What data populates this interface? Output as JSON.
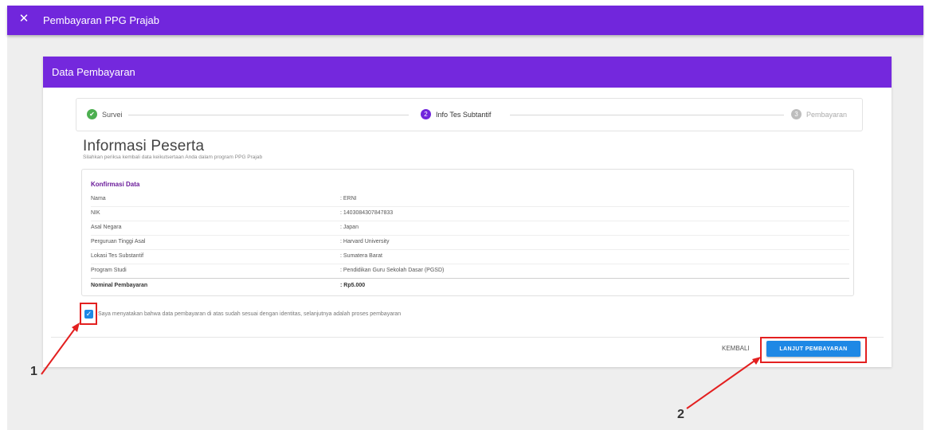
{
  "appbar": {
    "close_icon": "close-icon",
    "title": "Pembayaran PPG Prajab"
  },
  "card": {
    "header_title": "Data Pembayaran"
  },
  "stepper": {
    "steps": [
      {
        "number": "1",
        "label": "Survei",
        "state": "done"
      },
      {
        "number": "2",
        "label": "Info Tes Subtantif",
        "state": "active"
      },
      {
        "number": "3",
        "label": "Pembayaran",
        "state": "inactive"
      }
    ]
  },
  "info": {
    "title": "Informasi Peserta",
    "subtitle": "Silahkan periksa kembali data keikutsertaan Anda dalam program PPG Prajab"
  },
  "confirm": {
    "title": "Konfirmasi Data",
    "rows": [
      {
        "key": "Nama",
        "value": ": ERNI"
      },
      {
        "key": "NIK",
        "value": ": 1403084307847833"
      },
      {
        "key": "Asal Negara",
        "value": ": Japan"
      },
      {
        "key": "Perguruan Tinggi Asal",
        "value": ": Harvard University"
      },
      {
        "key": "Lokasi Tes Substantif",
        "value": ": Sumatera Barat"
      },
      {
        "key": "Program Studi",
        "value": ": Pendidikan Guru Sekolah Dasar (PGSD)"
      }
    ],
    "total": {
      "key": "Nominal Pembayaran",
      "value": ": Rp5.000"
    }
  },
  "agreement": {
    "checked": true,
    "text": "Saya menyatakan bahwa data pembayaran di atas sudah sesuai dengan identitas, selanjutnya adalah proses pembayaran"
  },
  "footer": {
    "back_label": "KEMBALI",
    "next_label": "LANJUT PEMBAYARAN"
  },
  "annotations": {
    "label_1": "1",
    "label_2": "2",
    "color": "#e32020"
  },
  "colors": {
    "appbar": "#7126dc",
    "primary_button": "#1e88e5",
    "success": "#4caf50"
  }
}
